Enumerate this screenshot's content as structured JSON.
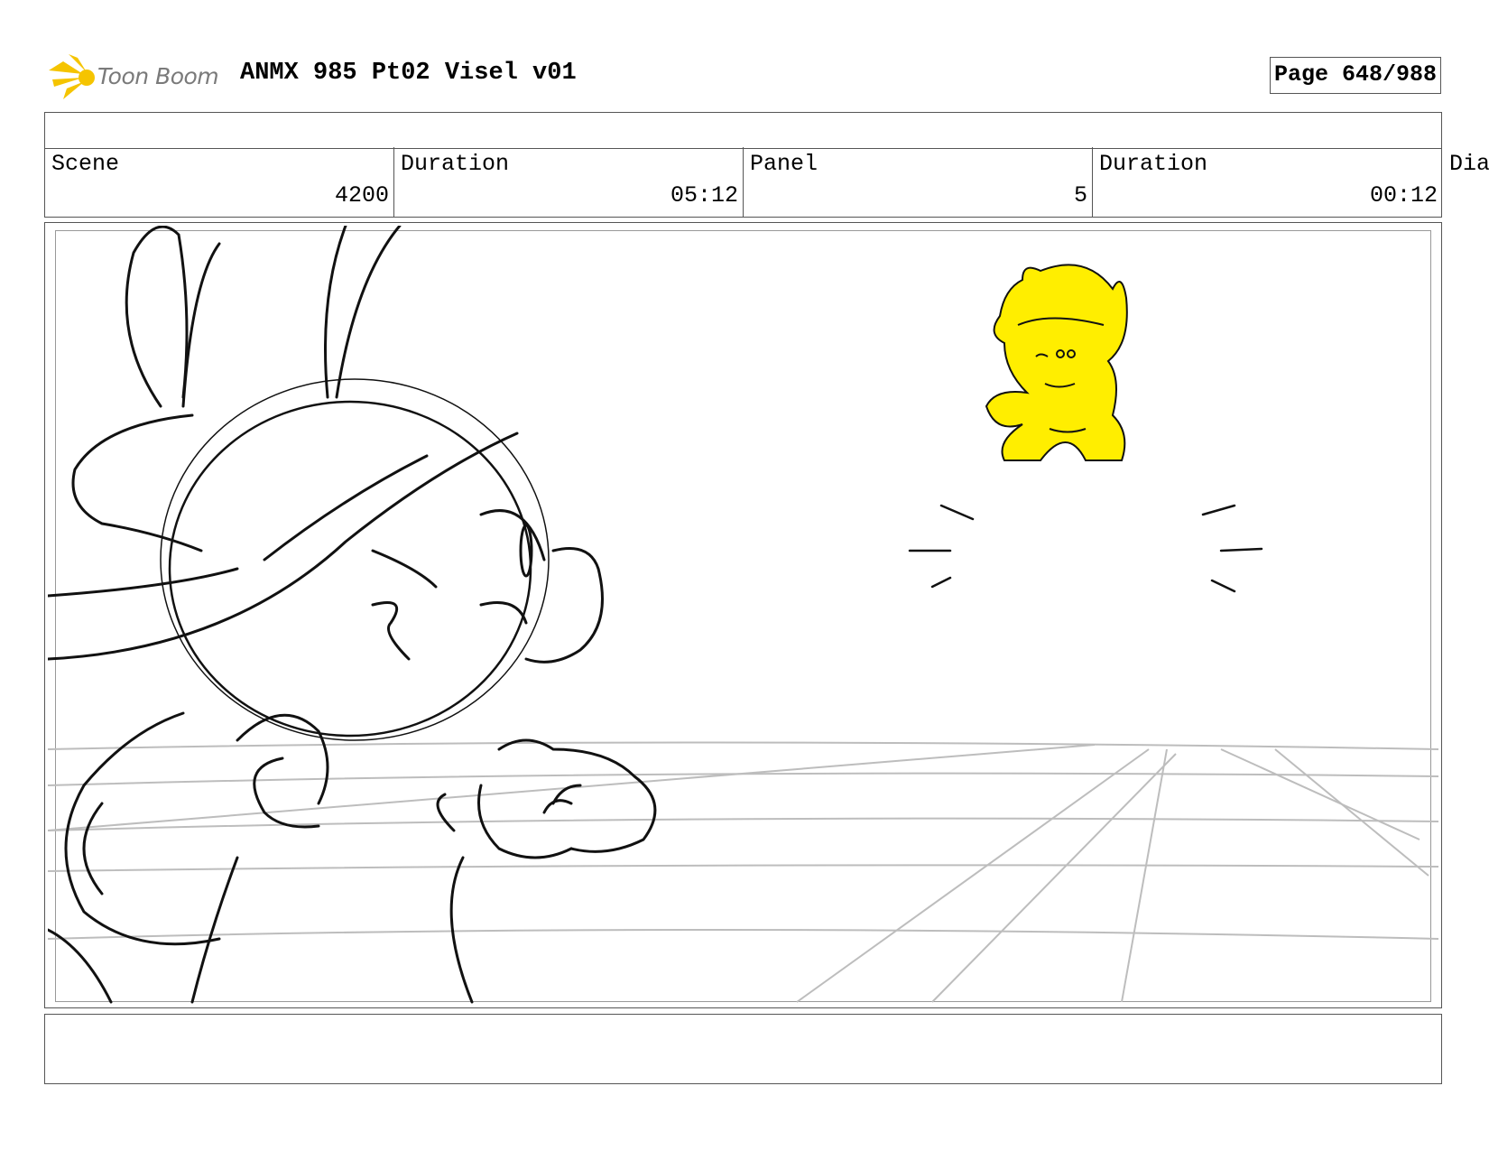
{
  "header": {
    "logo_text": "Toon Boom",
    "title": "ANMX 985 Pt02 Visel v01",
    "page": "Page 648/988"
  },
  "info": {
    "scene_label": "Scene",
    "scene_value": "4200",
    "scene_duration_label": "Duration",
    "scene_duration_value": "05:12",
    "panel_label": "Panel",
    "panel_value": "5",
    "panel_duration_label": "Duration",
    "panel_duration_value": "00:12",
    "dialog_label_partial": "Dia"
  },
  "colors": {
    "logo_accent": "#f5c400",
    "character_highlight": "#ffee00",
    "sketch_line": "#111111",
    "guide_line": "#bdbdbd"
  }
}
